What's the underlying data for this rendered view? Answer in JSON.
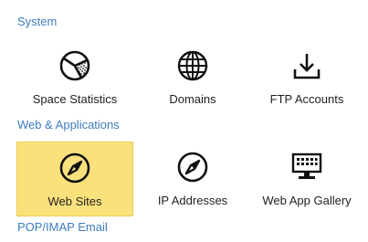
{
  "sections": [
    {
      "title": "System",
      "tiles": [
        {
          "label": "Space Statistics",
          "icon": "pie-chart-icon"
        },
        {
          "label": "Domains",
          "icon": "globe-icon"
        },
        {
          "label": "FTP Accounts",
          "icon": "download-icon"
        }
      ]
    },
    {
      "title": "Web & Applications",
      "tiles": [
        {
          "label": "Web Sites",
          "icon": "compass-icon",
          "selected": true
        },
        {
          "label": "IP Addresses",
          "icon": "compass-icon"
        },
        {
          "label": "Web App Gallery",
          "icon": "keyboard-icon"
        }
      ]
    },
    {
      "title": "POP/IMAP Email",
      "tiles": []
    }
  ],
  "colors": {
    "section_title": "#3b7bbf",
    "selected_tile_bg": "#fbe17c",
    "icon_stroke": "#111111"
  }
}
